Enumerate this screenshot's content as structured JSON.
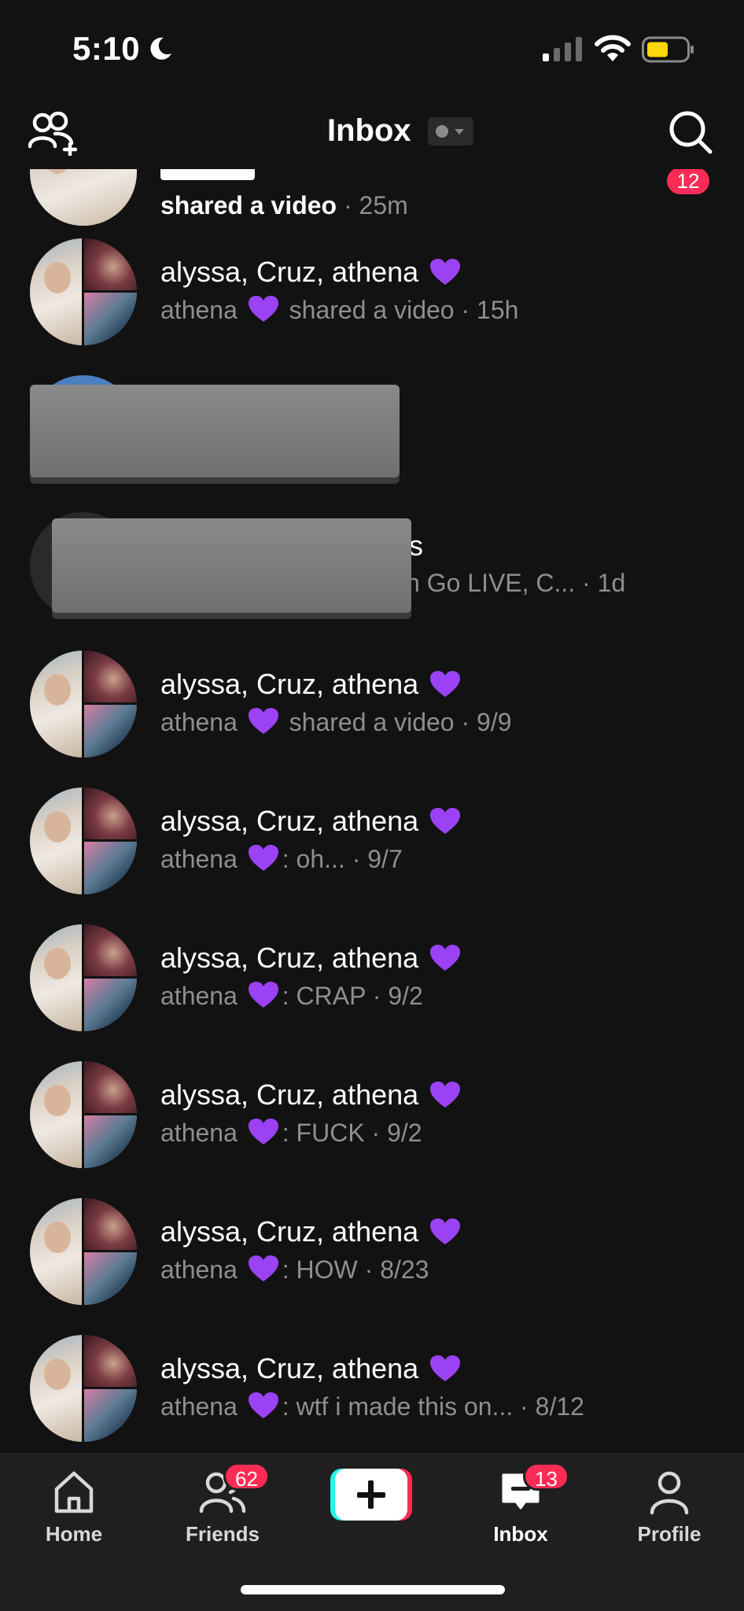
{
  "status_bar": {
    "time": "5:10",
    "battery_color": "#ffd60a"
  },
  "header": {
    "title": "Inbox"
  },
  "colors": {
    "background": "#121212",
    "badge": "#fe2c55",
    "secondary_text": "#8e8e93"
  },
  "partial_row": {
    "preview_text": "shared a video",
    "time": "25m",
    "unread": "12"
  },
  "rows": [
    {
      "name": "alyssa, Cruz, athena",
      "sender": "athena",
      "message": "shared a video",
      "separator": " ",
      "time": "15h"
    },
    {
      "name": "alyssa, Cruz, athena",
      "sender": "athena",
      "message": "shared a video",
      "separator": " ",
      "time": "9/9"
    },
    {
      "name": "alyssa, Cruz, athena",
      "sender": "athena",
      "message": "oh...",
      "separator": ": ",
      "time": "9/7"
    },
    {
      "name": "alyssa, Cruz, athena",
      "sender": "athena",
      "message": "CRAP",
      "separator": ": ",
      "time": "9/2"
    },
    {
      "name": "alyssa, Cruz, athena",
      "sender": "athena",
      "message": "FUCK",
      "separator": ": ",
      "time": "9/2"
    },
    {
      "name": "alyssa, Cruz, athena",
      "sender": "athena",
      "message": "HOW",
      "separator": ": ",
      "time": "8/23"
    },
    {
      "name": "alyssa, Cruz, athena",
      "sender": "athena",
      "message": "wtf i made this on...",
      "separator": ": ",
      "time": "8/12"
    }
  ],
  "redacted_row": {
    "name_tail": "s",
    "preview_tail": "n Go LIVE, C...",
    "time": "1d"
  },
  "bottom_nav": {
    "home": "Home",
    "friends": "Friends",
    "friends_badge": "62",
    "inbox": "Inbox",
    "inbox_badge": "13",
    "profile": "Profile"
  }
}
